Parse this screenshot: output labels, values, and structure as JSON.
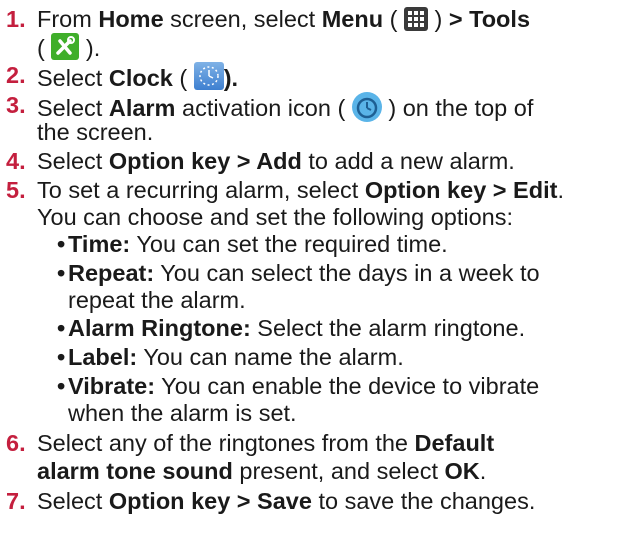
{
  "steps": [
    {
      "num": "1.",
      "text_a": "From ",
      "bold_a": "Home",
      "text_b": " screen, select ",
      "bold_b": "Menu",
      "text_c": " ( ",
      "text_d": " ) ",
      "bold_c": "> Tools",
      "text_e": "( ",
      "text_f": " )."
    },
    {
      "num": "2.",
      "text_a": "Select ",
      "bold_a": "Clock",
      "text_b": " ( ",
      "bold_b": ")."
    },
    {
      "num": "3.",
      "text_a": "Select ",
      "bold_a": "Alarm",
      "text_b": " activation icon ( ",
      "text_c": " ) on the top of",
      "text_d": "the screen."
    },
    {
      "num": "4.",
      "text_a": "Select ",
      "bold_a": "Option key > Add",
      "text_b": " to add a new alarm."
    },
    {
      "num": "5.",
      "text_a": "To set a recurring alarm, select ",
      "bold_a": "Option key > Edit",
      "text_b": ".",
      "text_c": "You can choose and set the following options:"
    },
    {
      "num": "6.",
      "text_a": "Select any of the ringtones from the ",
      "bold_a": "Default",
      "bold_b": "alarm tone sound",
      "text_b": " present, and select ",
      "bold_c": "OK",
      "text_c": "."
    },
    {
      "num": "7.",
      "text_a": "Select ",
      "bold_a": "Option key > Save",
      "text_b": " to save the changes."
    }
  ],
  "options": [
    {
      "label": "Time:",
      "text": " You can set the required time."
    },
    {
      "label": "Repeat:",
      "text": " You can select the days in a week to",
      "text2": "repeat the alarm."
    },
    {
      "label": "Alarm Ringtone:",
      "text": " Select the alarm ringtone."
    },
    {
      "label": "Label:",
      "text": " You can name the alarm."
    },
    {
      "label": "Vibrate:",
      "text": " You can enable the device to vibrate",
      "text2": "when the alarm is set."
    }
  ],
  "bullet_char": "•",
  "icons": {
    "menu": "menu-grid-icon",
    "tools": "tools-icon",
    "clock": "clock-icon",
    "alarm": "alarm-icon"
  },
  "colors": {
    "step_number": "#c41f3e",
    "text": "#1a1a1a",
    "tools_icon": "#3fae2a",
    "alarm_icon": "#5ab4e8"
  }
}
